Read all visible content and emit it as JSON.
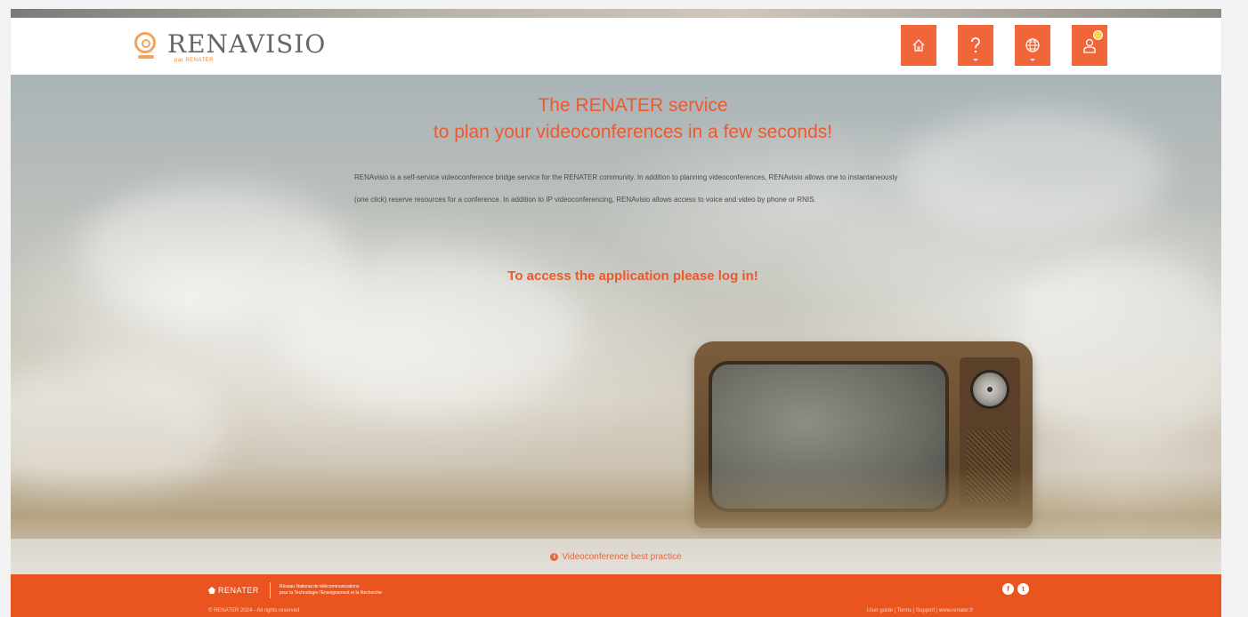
{
  "header": {
    "logo_text": "RENAVISIO",
    "logo_subtext": "par RENATER",
    "nav": [
      {
        "name": "home",
        "icon": "home-icon"
      },
      {
        "name": "help",
        "icon": "question-icon"
      },
      {
        "name": "language",
        "icon": "globe-icon"
      },
      {
        "name": "user",
        "icon": "user-icon"
      }
    ]
  },
  "hero": {
    "title_line1": "The RENATER service",
    "title_line2": "to plan your videoconferences in a few seconds!",
    "desc_p1": "RENAvisio is a self-service videoconference bridge service for the RENATER community. In addition to planning videoconferences, RENAvisio allows one to instantaneously",
    "desc_p2": "(one click) reserve resources for a conference. In addition to IP videoconferencing, RENAvisio allows access to voice and video by phone or RNIS.",
    "login_prompt": "To access the application please log in!"
  },
  "best_practice": {
    "label": "Videoconference best practice"
  },
  "footer": {
    "brand": "RENATER",
    "tagline_line1": "Réseau National de télécommunications",
    "tagline_line2": "pour la Technologie l'Enseignement et la Recherche",
    "social": [
      "f",
      "t"
    ],
    "copyright": "© RENATER 2024 - All rights reserved",
    "links": "User guide | Terms | Support | www.renater.fr"
  },
  "colors": {
    "accent": "#f0663a",
    "footer": "#e9541f",
    "title": "#ec5a2e"
  }
}
